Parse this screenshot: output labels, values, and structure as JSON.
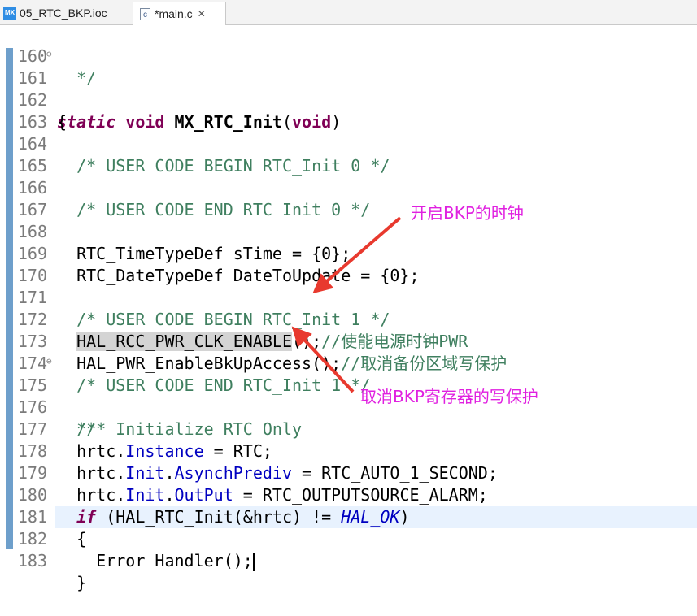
{
  "tabs": [
    {
      "icon": "mx-icon",
      "label": "05_RTC_BKP.ioc"
    },
    {
      "icon": "c-file-icon",
      "label": "*main.c",
      "close": "✕"
    }
  ],
  "editor": {
    "lines": [
      {
        "n": "160",
        "code": "  */"
      },
      {
        "n": "161",
        "code": "static void MX_RTC_Init(void)"
      },
      {
        "n": "162",
        "code": "{"
      },
      {
        "n": "163",
        "code": ""
      },
      {
        "n": "164",
        "code": "  /* USER CODE BEGIN RTC_Init 0 */"
      },
      {
        "n": "165",
        "code": ""
      },
      {
        "n": "166",
        "code": "  /* USER CODE END RTC_Init 0 */"
      },
      {
        "n": "167",
        "code": ""
      },
      {
        "n": "168",
        "code": "  RTC_TimeTypeDef sTime = {0};"
      },
      {
        "n": "169",
        "code": "  RTC_DateTypeDef DateToUpdate = {0};"
      },
      {
        "n": "170",
        "code": ""
      },
      {
        "n": "171",
        "code": "  /* USER CODE BEGIN RTC_Init 1 */"
      },
      {
        "n": "172",
        "code": "  HAL_RCC_PWR_CLK_ENABLE();//使能电源时钟PWR"
      },
      {
        "n": "173",
        "code": "  HAL_PWR_EnableBkUpAccess();//取消备份区域写保护"
      },
      {
        "n": "174",
        "code": "  /* USER CODE END RTC_Init 1 */"
      },
      {
        "n": "175",
        "code": "  /** Initialize RTC Only"
      },
      {
        "n": "176",
        "code": "  */"
      },
      {
        "n": "177",
        "code": "  hrtc.Instance = RTC;"
      },
      {
        "n": "178",
        "code": "  hrtc.Init.AsynchPrediv = RTC_AUTO_1_SECOND;"
      },
      {
        "n": "179",
        "code": "  hrtc.Init.OutPut = RTC_OUTPUTSOURCE_ALARM;"
      },
      {
        "n": "180",
        "code": "  if (HAL_RTC_Init(&hrtc) != HAL_OK)"
      },
      {
        "n": "181",
        "code": "  {"
      },
      {
        "n": "182",
        "code": "    Error_Handler();"
      },
      {
        "n": "183",
        "code": "  }"
      }
    ],
    "fold_marker": "⊖"
  },
  "annotations": {
    "enable_bkp_clock": "开启BKP的时钟",
    "disable_bkp_write_protect": "取消BKP寄存器的写保护"
  },
  "colors": {
    "annotation": "#e020e0",
    "arrow": "#e8392e",
    "keyword": "#7f0055",
    "comment": "#3f7f5f",
    "field": "#0000c0"
  }
}
